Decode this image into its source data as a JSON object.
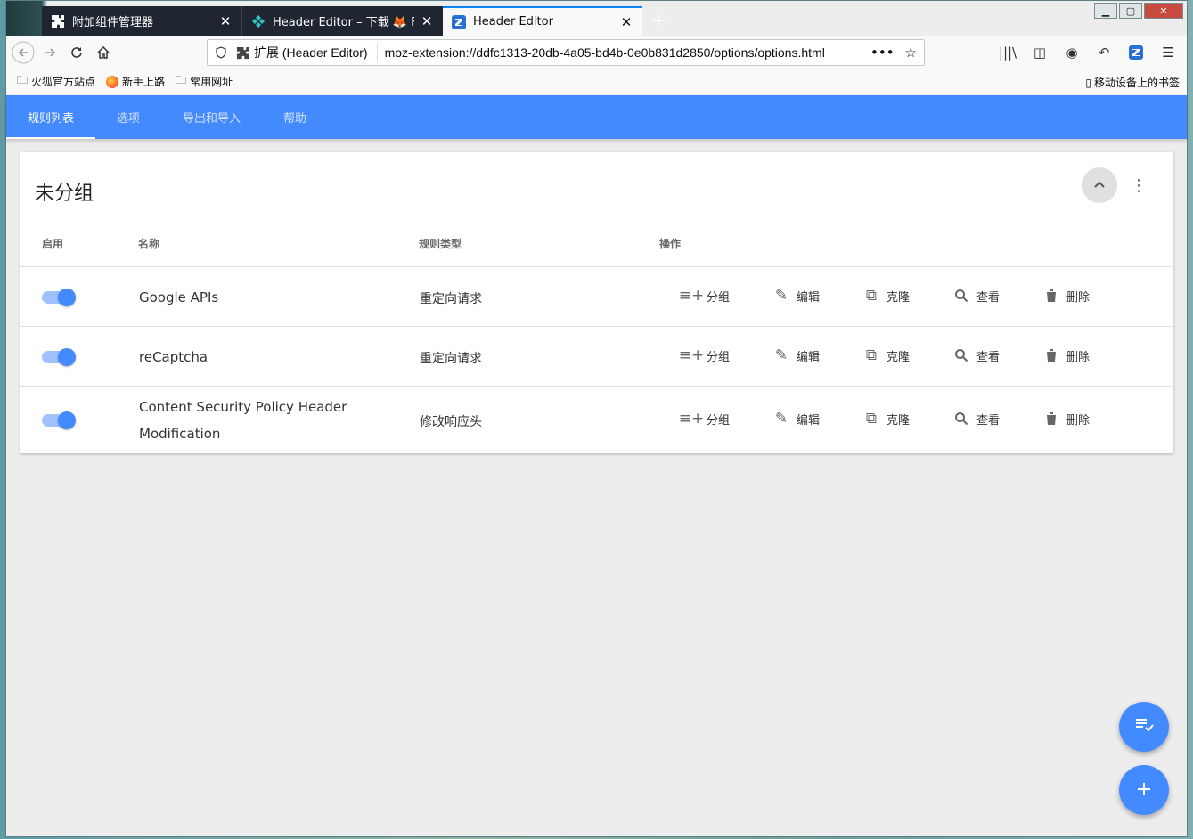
{
  "browser": {
    "tabs": [
      {
        "title": "附加组件管理器",
        "icon": "puzzle-icon"
      },
      {
        "title": "Header Editor – 下载 🦊 Firefox",
        "icon": "addon-icon"
      },
      {
        "title": "Header Editor",
        "icon": "header-editor-icon"
      }
    ],
    "close_glyph": "✕",
    "new_tab_glyph": "+",
    "url_ext_label": "扩展 (Header Editor)",
    "url": "moz-extension://ddfc1313-20db-4a05-bd4b-0e0b831d2850/options/options.html",
    "bookmarks": [
      "火狐官方站点",
      "新手上路",
      "常用网址"
    ],
    "mobile_bookmarks": "移动设备上的书签"
  },
  "app": {
    "tabs": [
      "规则列表",
      "选项",
      "导出和导入",
      "帮助"
    ],
    "group_title": "未分组",
    "columns": {
      "enabled": "启用",
      "name": "名称",
      "type": "规则类型",
      "actions": "操作"
    },
    "actions": {
      "group": "分组",
      "edit": "编辑",
      "clone": "克隆",
      "view": "查看",
      "delete": "删除"
    },
    "rules": [
      {
        "name": "Google APIs",
        "type": "重定向请求",
        "enabled": true
      },
      {
        "name": "reCaptcha",
        "type": "重定向请求",
        "enabled": true
      },
      {
        "name": "Content Security Policy Header Modification",
        "type": "修改响应头",
        "enabled": true
      }
    ]
  },
  "colors": {
    "accent": "#448aff",
    "toggle_track": "#9fc1ff"
  }
}
